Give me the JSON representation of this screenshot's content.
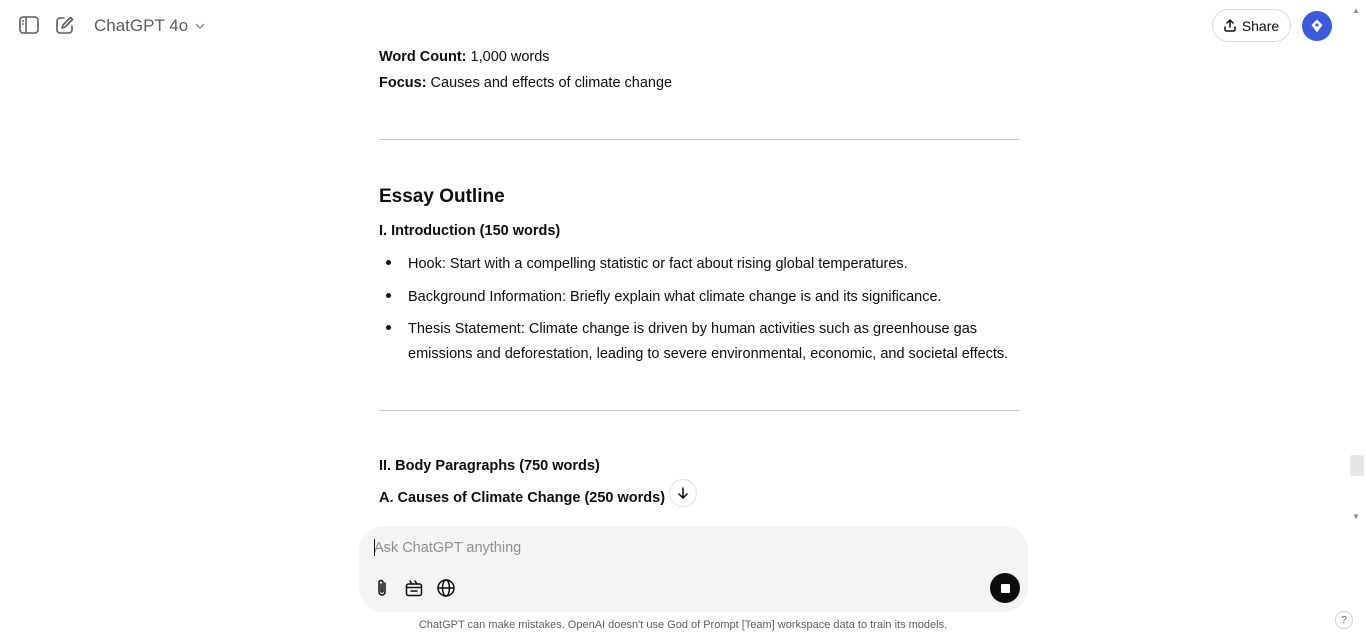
{
  "header": {
    "model_name": "ChatGPT 4o",
    "share_label": "Share"
  },
  "message": {
    "meta": [
      {
        "label": "Word Count:",
        "value": " 1,000 words"
      },
      {
        "label": "Focus:",
        "value": " Causes and effects of climate change"
      }
    ],
    "outline_title": "Essay Outline",
    "intro_heading": "I. Introduction (150 words)",
    "intro_bullets": [
      "Hook: Start with a compelling statistic or fact about rising global temperatures.",
      "Background Information: Briefly explain what climate change is and its significance.",
      "Thesis Statement: Climate change is driven by human activities such as greenhouse gas emissions and deforestation, leading to severe environmental, economic, and societal effects."
    ],
    "body_heading": "II. Body Paragraphs (750 words)",
    "causes_heading": "A. Causes of Climate Change (250 words)"
  },
  "composer": {
    "placeholder": "Ask ChatGPT anything"
  },
  "footer": {
    "disclaimer": "ChatGPT can make mistakes. OpenAI doesn't use God of Prompt [Team] workspace data to train its models.",
    "help_label": "?"
  },
  "icons": [
    "sidebar-toggle-icon",
    "new-chat-icon",
    "chevron-down-icon",
    "share-icon",
    "attach-icon",
    "tools-icon",
    "globe-icon",
    "arrow-down-icon",
    "stop-icon"
  ],
  "colors": {
    "avatar": "#3b5bdb",
    "composer_bg": "#f4f4f4",
    "stop_button": "#0d0d0d"
  }
}
